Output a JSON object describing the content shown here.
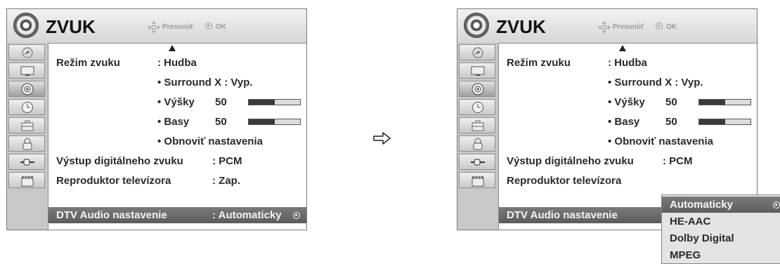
{
  "menu": {
    "title": "ZVUK",
    "hint_move": "Presunúť",
    "hint_ok": "OK",
    "sidebar_items": [
      {
        "name": "satellite-icon"
      },
      {
        "name": "tv-icon"
      },
      {
        "name": "speaker-icon",
        "active": true
      },
      {
        "name": "clock-icon"
      },
      {
        "name": "briefcase-icon"
      },
      {
        "name": "lock-icon"
      },
      {
        "name": "input-plug-icon"
      },
      {
        "name": "clapperboard-icon"
      }
    ],
    "rows": {
      "sound_mode_label": "Režim zvuku",
      "sound_mode_value": ": Hudba",
      "surround": "• Surround X : Vyp.",
      "treble_label": "• Výšky",
      "treble_value": "50",
      "treble_level": 50,
      "bass_label": "• Basy",
      "bass_value": "50",
      "bass_level": 50,
      "reset": "• Obnoviť nastavenia",
      "digital_out_label": "Výstup digitálneho zvuku",
      "digital_out_value": ": PCM",
      "tv_speaker_label": "Reproduktor televízora",
      "tv_speaker_value": ": Zap.",
      "dtv_audio_label": "DTV Audio nastavenie",
      "dtv_audio_value": ": Automaticky"
    }
  },
  "dropdown": {
    "options": [
      "Automaticky",
      "HE-AAC",
      "Dolby Digital",
      "MPEG"
    ],
    "selected_index": 0
  }
}
